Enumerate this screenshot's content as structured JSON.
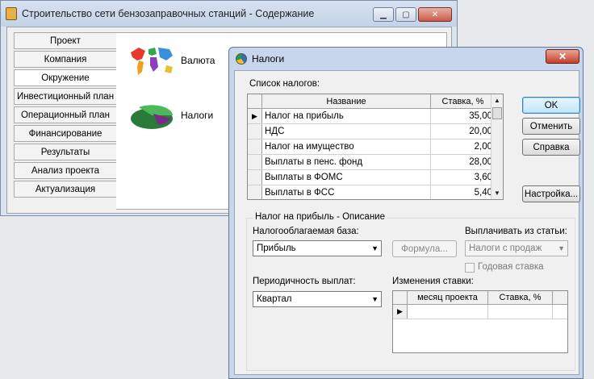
{
  "main_window": {
    "title": "Строительство сети бензозаправочных станций - Содержание",
    "nav_items": [
      "Проект",
      "Компания",
      "Окружение",
      "Инвестиционный план",
      "Операционный план",
      "Финансирование",
      "Результаты",
      "Анализ проекта",
      "Актуализация"
    ],
    "active_nav": "Окружение",
    "features": {
      "currency": "Валюта",
      "taxes": "Налоги"
    }
  },
  "dialog": {
    "title": "Налоги",
    "list_label": "Список налогов:",
    "columns": {
      "name": "Название",
      "rate": "Ставка, %"
    },
    "rows": [
      {
        "name": "Налог на прибыль",
        "rate": "35,00"
      },
      {
        "name": "НДС",
        "rate": "20,00"
      },
      {
        "name": "Налог на имущество",
        "rate": "2,00"
      },
      {
        "name": "Выплаты в пенс. фонд",
        "rate": "28,00"
      },
      {
        "name": "Выплаты в ФОМС",
        "rate": "3,60"
      },
      {
        "name": "Выплаты в ФСС",
        "rate": "5,40"
      }
    ],
    "buttons": {
      "ok": "OK",
      "cancel": "Отменить",
      "help": "Справка",
      "settings": "Настройка..."
    },
    "description": {
      "group_title": "Налог на прибыль - Описание",
      "base_label": "Налогооблагаемая база:",
      "base_value": "Прибыль",
      "formula_button": "Формула...",
      "pay_from_label": "Выплачивать из статьи:",
      "pay_from_value": "Налоги с продаж",
      "annual_rate_label": "Годовая ставка",
      "periodicity_label": "Периодичность выплат:",
      "periodicity_value": "Квартал",
      "changes_label": "Изменения ставки:",
      "changes_columns": {
        "month": "месяц проекта",
        "rate": "Ставка, %"
      }
    }
  }
}
